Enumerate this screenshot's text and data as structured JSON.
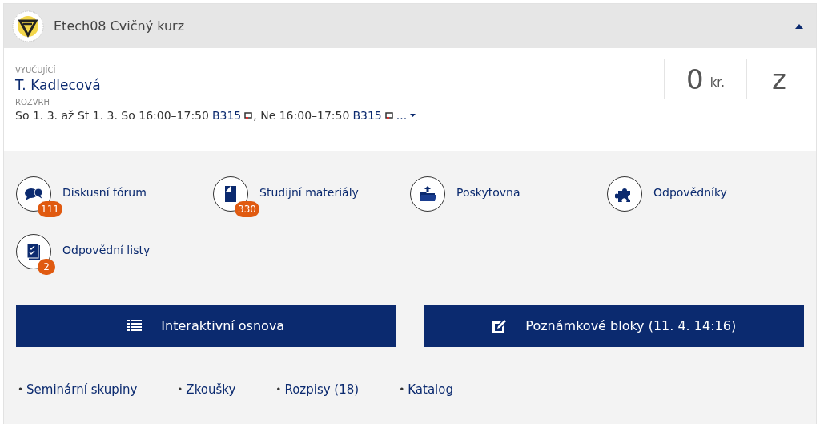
{
  "header": {
    "title": "Etech08 Cvičný kurz",
    "expanded": true
  },
  "teacher": {
    "label": "VYUČUJÍCÍ",
    "name": "T. Kadlecová"
  },
  "schedule": {
    "label": "ROZVRH",
    "more": "...",
    "parts": [
      {
        "kind": "text",
        "text": "So 1. 3. až St 1. 3. So 16:00–17:50"
      },
      {
        "kind": "room",
        "text": "B315"
      },
      {
        "kind": "text",
        "text": ", Ne 16:00–17:50"
      },
      {
        "kind": "room",
        "text": "B315"
      }
    ]
  },
  "credits": {
    "value": "0",
    "unit": "kr."
  },
  "completion": "z",
  "tiles": [
    {
      "kind": "forum",
      "label": "Diskusní fórum",
      "badge": "111"
    },
    {
      "kind": "materials",
      "label": "Studijní materiály",
      "badge": "330"
    },
    {
      "kind": "upload",
      "label": "Poskytovna"
    },
    {
      "kind": "puzzle",
      "label": "Odpovědníky"
    },
    {
      "kind": "sheets",
      "label": "Odpovědní listy",
      "badge": "2"
    }
  ],
  "buttons": [
    {
      "kind": "outline",
      "label": "Interaktivní osnova"
    },
    {
      "kind": "notes",
      "label": "Poznámkové bloky (11. 4. 14:16)"
    }
  ],
  "links": [
    {
      "bullet": "•",
      "label": "Seminární skupiny"
    },
    {
      "bullet": "•",
      "label": "Zkoušky"
    },
    {
      "bullet": "•",
      "label": "Rozpisy (18)"
    },
    {
      "bullet": "•",
      "label": "Katalog"
    }
  ]
}
